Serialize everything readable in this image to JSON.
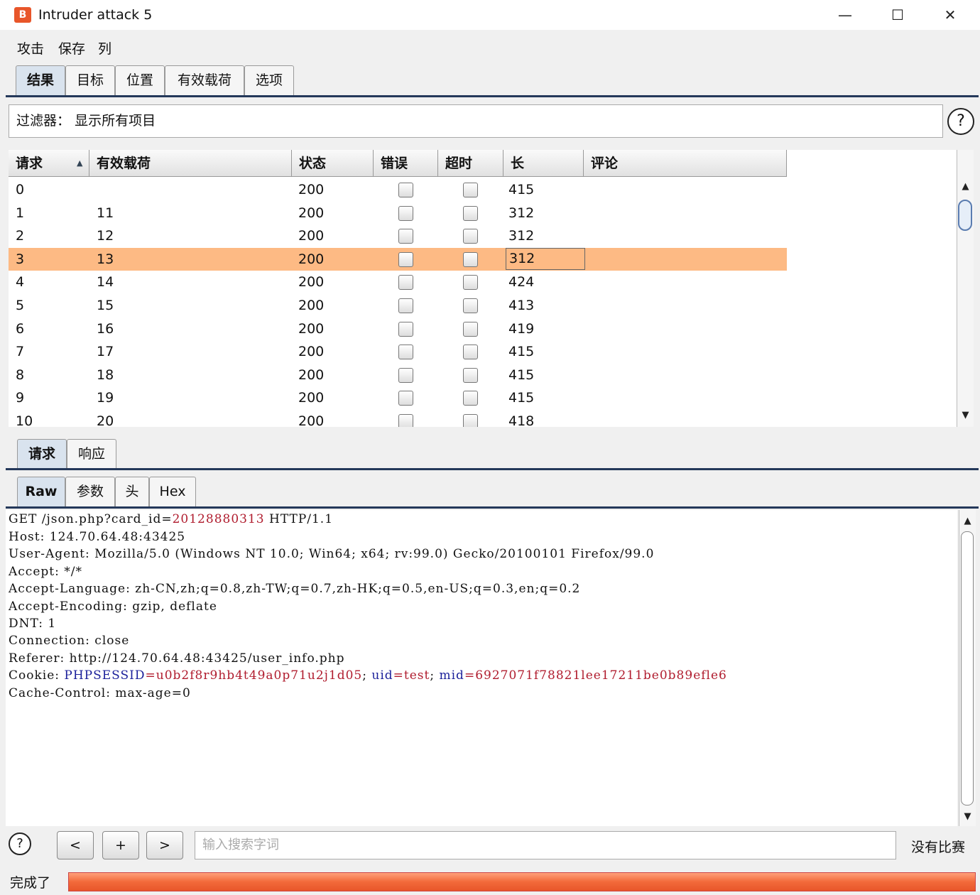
{
  "window": {
    "title": "Intruder attack 5",
    "minimize": "—",
    "maximize": "☐",
    "close": "✕"
  },
  "menu": [
    "攻击",
    "保存",
    "列"
  ],
  "tabs": [
    "结果",
    "目标",
    "位置",
    "有效载荷",
    "选项"
  ],
  "filter": {
    "label": "过滤器：",
    "value": "显示所有项目"
  },
  "help": "?",
  "table": {
    "sort_indicator": "▲",
    "columns": [
      "请求",
      "有效载荷",
      "状态",
      "错误",
      "超时",
      "长",
      "评论"
    ],
    "rows": [
      {
        "req": "0",
        "payload": "",
        "status": "200",
        "error": false,
        "timeout": false,
        "length": "415",
        "comment": ""
      },
      {
        "req": "1",
        "payload": "11",
        "status": "200",
        "error": false,
        "timeout": false,
        "length": "312",
        "comment": ""
      },
      {
        "req": "2",
        "payload": "12",
        "status": "200",
        "error": false,
        "timeout": false,
        "length": "312",
        "comment": ""
      },
      {
        "req": "3",
        "payload": "13",
        "status": "200",
        "error": false,
        "timeout": false,
        "length": "312",
        "comment": "",
        "selected": true
      },
      {
        "req": "4",
        "payload": "14",
        "status": "200",
        "error": false,
        "timeout": false,
        "length": "424",
        "comment": ""
      },
      {
        "req": "5",
        "payload": "15",
        "status": "200",
        "error": false,
        "timeout": false,
        "length": "413",
        "comment": ""
      },
      {
        "req": "6",
        "payload": "16",
        "status": "200",
        "error": false,
        "timeout": false,
        "length": "419",
        "comment": ""
      },
      {
        "req": "7",
        "payload": "17",
        "status": "200",
        "error": false,
        "timeout": false,
        "length": "415",
        "comment": ""
      },
      {
        "req": "8",
        "payload": "18",
        "status": "200",
        "error": false,
        "timeout": false,
        "length": "415",
        "comment": ""
      },
      {
        "req": "9",
        "payload": "19",
        "status": "200",
        "error": false,
        "timeout": false,
        "length": "415",
        "comment": ""
      },
      {
        "req": "10",
        "payload": "20",
        "status": "200",
        "error": false,
        "timeout": false,
        "length": "418",
        "comment": ""
      }
    ]
  },
  "detail_tabs": [
    "请求",
    "响应"
  ],
  "view_tabs": [
    "Raw",
    "参数",
    "头",
    "Hex"
  ],
  "request": {
    "l0a": "GET /json.php?card_id=",
    "l0b": "20128880313",
    "l0c": " HTTP/1.1",
    "lines": [
      "Host: 124.70.64.48:43425",
      "User-Agent: Mozilla/5.0 (Windows NT 10.0; Win64; x64; rv:99.0) Gecko/20100101 Firefox/99.0",
      "Accept: */*",
      "Accept-Language: zh-CN,zh;q=0.8,zh-TW;q=0.7,zh-HK;q=0.5,en-US;q=0.3,en;q=0.2",
      "Accept-Encoding: gzip, deflate",
      "DNT: 1",
      "Connection: close",
      "Referer: http://124.70.64.48:43425/user_info.php"
    ],
    "cookie": {
      "label": "Cookie: ",
      "k1": "PHPSESSID",
      "v1": "=u0b2f8r9hb4t49a0p71u2j1d05",
      "sep1": "; ",
      "k2": "uid",
      "v2": "=test",
      "sep2": "; ",
      "k3": "mid",
      "v3": "=6927071f78821lee17211be0b89efle6"
    },
    "last": "Cache-Control: max-age=0"
  },
  "search": {
    "prev": "<",
    "add": "+",
    "next": ">",
    "placeholder": "输入搜索字词",
    "matches": "没有比赛"
  },
  "status": {
    "label": "完成了",
    "progress": 1.0
  }
}
